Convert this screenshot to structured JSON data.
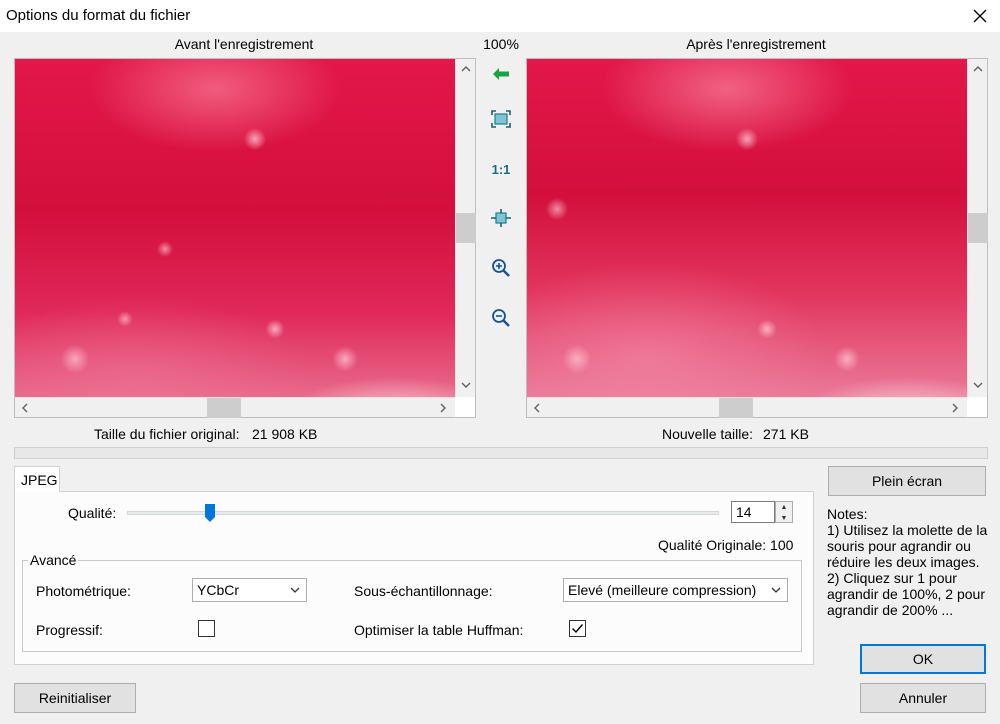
{
  "window": {
    "title": "Options du format du fichier"
  },
  "preview": {
    "before_label": "Avant l'enregistrement",
    "after_label": "Après l'enregistrement",
    "zoom": "100%",
    "original_size_label": "Taille du fichier original:",
    "original_size_value": "21 908 KB",
    "new_size_label": "Nouvelle taille:",
    "new_size_value": "271 KB"
  },
  "toolbar": {
    "icons": [
      "arrow-left-icon",
      "fit-window-icon",
      "actual-size-icon",
      "fit-width-icon",
      "zoom-in-icon",
      "zoom-out-icon"
    ],
    "actual_size_text": "1:1"
  },
  "tabs": [
    {
      "label": "JPEG",
      "active": true
    }
  ],
  "jpeg": {
    "quality_label": "Qualité:",
    "quality_value": "14",
    "quality_fraction": 0.14,
    "original_quality": "Qualité Originale: 100",
    "advanced": {
      "title": "Avancé",
      "photometric_label": "Photométrique:",
      "photometric_value": "YCbCr",
      "subsampling_label": "Sous-échantillonnage:",
      "subsampling_value": "Elevé (meilleure compression)",
      "progressive_label": "Progressif:",
      "progressive_checked": false,
      "huffman_label": "Optimiser la table Huffman:",
      "huffman_checked": true
    }
  },
  "buttons": {
    "fullscreen": "Plein écran",
    "ok": "OK",
    "cancel": "Annuler",
    "reset": "Reinitialiser"
  },
  "notes": {
    "title": "Notes:",
    "lines": [
      "1) Utilisez la molette de la",
      "souris pour agrandir ou",
      "réduire les deux images.",
      "2) Cliquez sur 1 pour",
      "agrandir de 100%, 2 pour",
      "agrandir de 200% ..."
    ]
  },
  "colors": {
    "accent": "#0078d7",
    "icon_green": "#1aa340",
    "icon_teal": "#1a7f8f"
  }
}
